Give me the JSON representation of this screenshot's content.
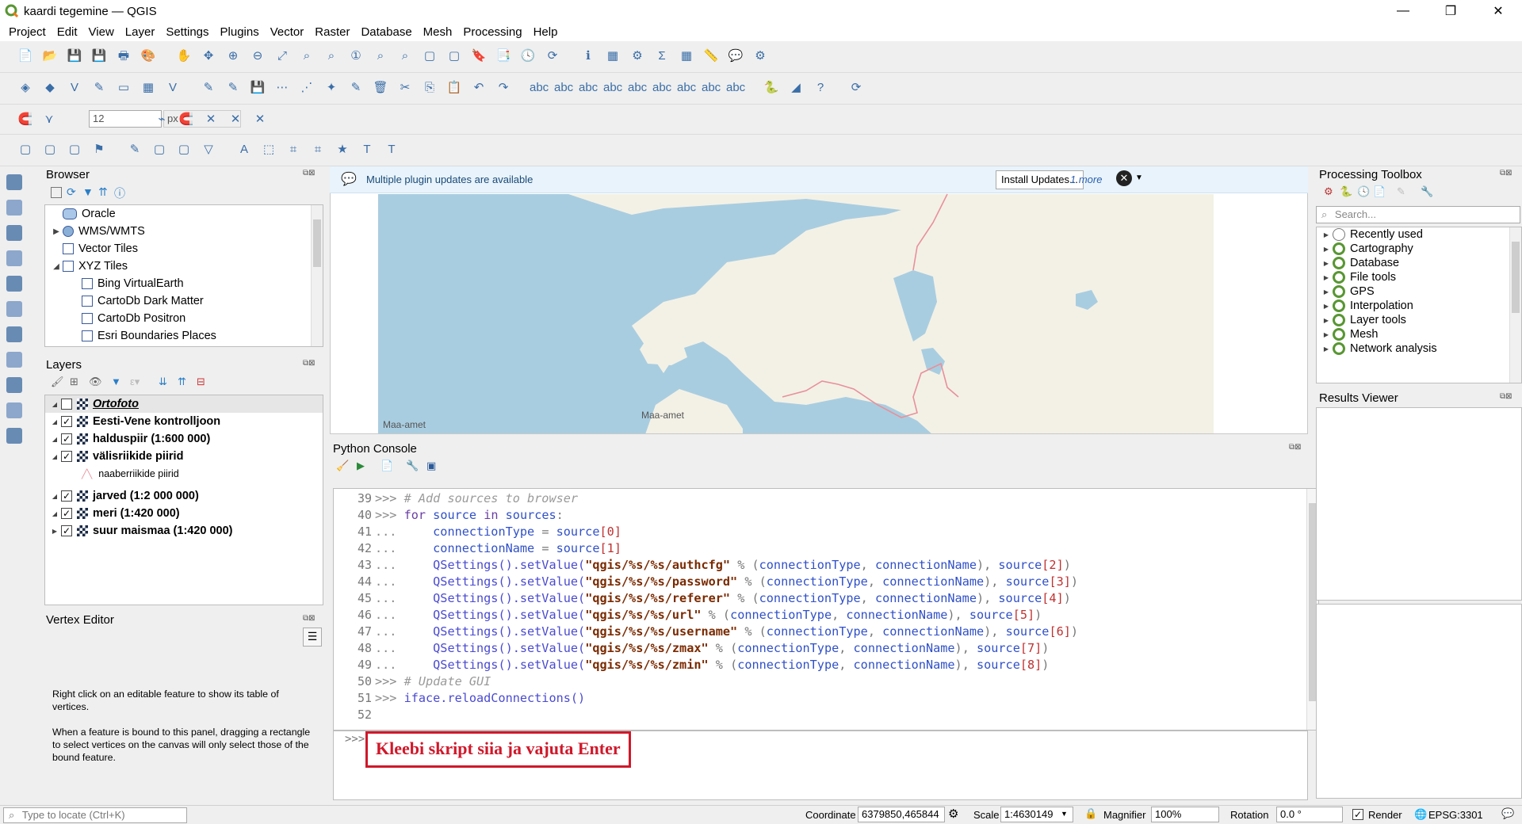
{
  "window": {
    "title": "kaardi tegemine — QGIS",
    "controls": [
      "—",
      "❐",
      "✕"
    ]
  },
  "menu": [
    "Project",
    "Edit",
    "View",
    "Layer",
    "Settings",
    "Plugins",
    "Vector",
    "Raster",
    "Database",
    "Mesh",
    "Processing",
    "Help"
  ],
  "snapping": {
    "tolerance": "12",
    "unit": "px"
  },
  "browser": {
    "title": "Browser",
    "items": [
      {
        "label": "Oracle",
        "indent": 1,
        "expand": ""
      },
      {
        "label": "WMS/WMTS",
        "indent": 0,
        "expand": "▶"
      },
      {
        "label": "Vector Tiles",
        "indent": 1,
        "expand": ""
      },
      {
        "label": "XYZ Tiles",
        "indent": 0,
        "expand": "◢"
      },
      {
        "label": "Bing VirtualEarth",
        "indent": 2,
        "expand": ""
      },
      {
        "label": "CartoDb Dark Matter",
        "indent": 2,
        "expand": ""
      },
      {
        "label": "CartoDb Positron",
        "indent": 2,
        "expand": ""
      },
      {
        "label": "Esri Boundaries Places",
        "indent": 2,
        "expand": ""
      }
    ]
  },
  "layers": {
    "title": "Layers",
    "items": [
      {
        "label": "Ortofoto",
        "checked": false,
        "style": "italic-bold-underline"
      },
      {
        "label": "Eesti-Vene kontrolljoon",
        "checked": true,
        "style": "bold"
      },
      {
        "label": "halduspiir (1:600 000)",
        "checked": true,
        "style": "bold"
      },
      {
        "label": "välisriikide piirid",
        "checked": true,
        "style": "bold"
      },
      {
        "label": "naaberriikide piirid",
        "checked": null,
        "style": "legend"
      },
      {
        "label": "jarved (1:2 000 000)",
        "checked": true,
        "style": "bold"
      },
      {
        "label": "meri (1:420 000)",
        "checked": true,
        "style": "bold"
      },
      {
        "label": "suur maismaa (1:420 000)",
        "checked": true,
        "style": "bold"
      }
    ]
  },
  "vertex_editor": {
    "title": "Vertex Editor",
    "text1": "Right click on an editable feature to show its table of vertices.",
    "text2": "When a feature is bound to this panel, dragging a rectangle to select vertices on the canvas will only select those of the bound feature."
  },
  "notification": {
    "text": "Multiple plugin updates are available",
    "button": "Install Updates...",
    "more": "1 more"
  },
  "map": {
    "attribution1": "Maa-amet",
    "attribution2": "Maa-amet",
    "colors": {
      "sea": "#a9cde0",
      "land": "#f3f1e6",
      "border": "#e8909a"
    }
  },
  "python_console": {
    "title": "Python Console",
    "lines": [
      {
        "n": "39",
        "parts": [
          [
            "pr",
            ">>> "
          ],
          [
            "cm",
            "# Add sources to browser"
          ]
        ]
      },
      {
        "n": "40",
        "parts": [
          [
            "pr",
            ">>> "
          ],
          [
            "kw",
            "for"
          ],
          [
            "op",
            " "
          ],
          [
            "id",
            "source"
          ],
          [
            "op",
            " "
          ],
          [
            "kw",
            "in"
          ],
          [
            "op",
            " "
          ],
          [
            "id",
            "sources"
          ],
          [
            "op",
            ":"
          ]
        ]
      },
      {
        "n": "41",
        "parts": [
          [
            "pr",
            "...     "
          ],
          [
            "id",
            "connectionType"
          ],
          [
            "op",
            " = "
          ],
          [
            "id",
            "source"
          ],
          [
            "nm",
            "[0]"
          ]
        ]
      },
      {
        "n": "42",
        "parts": [
          [
            "pr",
            "...     "
          ],
          [
            "id",
            "connectionName"
          ],
          [
            "op",
            " = "
          ],
          [
            "id",
            "source"
          ],
          [
            "nm",
            "[1]"
          ]
        ]
      },
      {
        "n": "43",
        "parts": [
          [
            "pr",
            "...     "
          ],
          [
            "fn",
            "QSettings().setValue("
          ],
          [
            "st",
            "\"qgis/%s/%s/authcfg\""
          ],
          [
            "op",
            " % ("
          ],
          [
            "id",
            "connectionType"
          ],
          [
            "op",
            ", "
          ],
          [
            "id",
            "connectionName"
          ],
          [
            "op",
            "), "
          ],
          [
            "id",
            "source"
          ],
          [
            "nm",
            "[2]"
          ],
          [
            "op",
            ")"
          ]
        ]
      },
      {
        "n": "44",
        "parts": [
          [
            "pr",
            "...     "
          ],
          [
            "fn",
            "QSettings().setValue("
          ],
          [
            "st",
            "\"qgis/%s/%s/password\""
          ],
          [
            "op",
            " % ("
          ],
          [
            "id",
            "connectionType"
          ],
          [
            "op",
            ", "
          ],
          [
            "id",
            "connectionName"
          ],
          [
            "op",
            "), "
          ],
          [
            "id",
            "source"
          ],
          [
            "nm",
            "[3]"
          ],
          [
            "op",
            ")"
          ]
        ]
      },
      {
        "n": "45",
        "parts": [
          [
            "pr",
            "...     "
          ],
          [
            "fn",
            "QSettings().setValue("
          ],
          [
            "st",
            "\"qgis/%s/%s/referer\""
          ],
          [
            "op",
            " % ("
          ],
          [
            "id",
            "connectionType"
          ],
          [
            "op",
            ", "
          ],
          [
            "id",
            "connectionName"
          ],
          [
            "op",
            "), "
          ],
          [
            "id",
            "source"
          ],
          [
            "nm",
            "[4]"
          ],
          [
            "op",
            ")"
          ]
        ]
      },
      {
        "n": "46",
        "parts": [
          [
            "pr",
            "...     "
          ],
          [
            "fn",
            "QSettings().setValue("
          ],
          [
            "st",
            "\"qgis/%s/%s/url\""
          ],
          [
            "op",
            " % ("
          ],
          [
            "id",
            "connectionType"
          ],
          [
            "op",
            ", "
          ],
          [
            "id",
            "connectionName"
          ],
          [
            "op",
            "), "
          ],
          [
            "id",
            "source"
          ],
          [
            "nm",
            "[5]"
          ],
          [
            "op",
            ")"
          ]
        ]
      },
      {
        "n": "47",
        "parts": [
          [
            "pr",
            "...     "
          ],
          [
            "fn",
            "QSettings().setValue("
          ],
          [
            "st",
            "\"qgis/%s/%s/username\""
          ],
          [
            "op",
            " % ("
          ],
          [
            "id",
            "connectionType"
          ],
          [
            "op",
            ", "
          ],
          [
            "id",
            "connectionName"
          ],
          [
            "op",
            "), "
          ],
          [
            "id",
            "source"
          ],
          [
            "nm",
            "[6]"
          ],
          [
            "op",
            ")"
          ]
        ]
      },
      {
        "n": "48",
        "parts": [
          [
            "pr",
            "...     "
          ],
          [
            "fn",
            "QSettings().setValue("
          ],
          [
            "st",
            "\"qgis/%s/%s/zmax\""
          ],
          [
            "op",
            " % ("
          ],
          [
            "id",
            "connectionType"
          ],
          [
            "op",
            ", "
          ],
          [
            "id",
            "connectionName"
          ],
          [
            "op",
            "), "
          ],
          [
            "id",
            "source"
          ],
          [
            "nm",
            "[7]"
          ],
          [
            "op",
            ")"
          ]
        ]
      },
      {
        "n": "49",
        "parts": [
          [
            "pr",
            "...     "
          ],
          [
            "fn",
            "QSettings().setValue("
          ],
          [
            "st",
            "\"qgis/%s/%s/zmin\""
          ],
          [
            "op",
            " % ("
          ],
          [
            "id",
            "connectionType"
          ],
          [
            "op",
            ", "
          ],
          [
            "id",
            "connectionName"
          ],
          [
            "op",
            "), "
          ],
          [
            "id",
            "source"
          ],
          [
            "nm",
            "[8]"
          ],
          [
            "op",
            ")"
          ]
        ]
      },
      {
        "n": "50",
        "parts": [
          [
            "pr",
            ">>> "
          ],
          [
            "cm",
            "# Update GUI"
          ]
        ]
      },
      {
        "n": "51",
        "parts": [
          [
            "pr",
            ">>> "
          ],
          [
            "fn",
            "iface.reloadConnections()"
          ]
        ]
      },
      {
        "n": "52",
        "parts": []
      }
    ],
    "prompt": ">>>",
    "annotation": "Kleebi skript siia ja vajuta Enter"
  },
  "processing": {
    "title": "Processing Toolbox",
    "search_placeholder": "Search...",
    "items": [
      "Recently used",
      "Cartography",
      "Database",
      "File tools",
      "GPS",
      "Interpolation",
      "Layer tools",
      "Mesh",
      "Network analysis"
    ]
  },
  "results_viewer": {
    "title": "Results Viewer"
  },
  "status": {
    "locate_placeholder": "Type to locate (Ctrl+K)",
    "coordinate_label": "Coordinate",
    "coordinate": "6379850,465844",
    "scale_label": "Scale",
    "scale": "1:4630149",
    "magnifier_label": "Magnifier",
    "magnifier": "100%",
    "rotation_label": "Rotation",
    "rotation": "0.0 °",
    "render_label": "Render",
    "crs": "EPSG:3301"
  }
}
